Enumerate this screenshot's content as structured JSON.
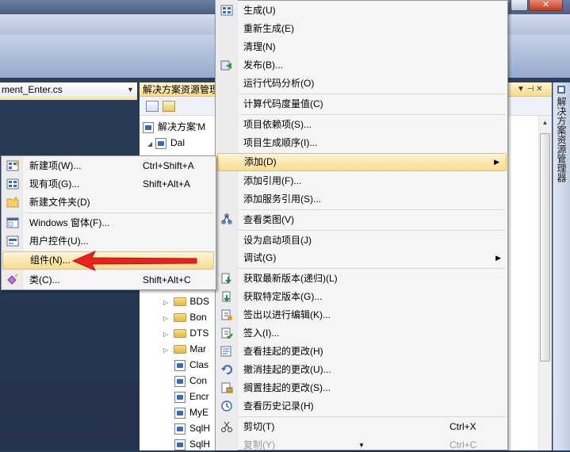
{
  "window": {
    "close_glyph": "✕"
  },
  "doc_tab": {
    "label": "ment_Enter.cs",
    "dropdown": "▼"
  },
  "solution_explorer": {
    "title": "解决方案资源管理",
    "title_buttons": "▼ ⊣ ✕",
    "side_tab": "解决方案资源管理器",
    "tree": {
      "solution": "解决方案'M",
      "project": "Dal",
      "folders": [
        "BDS",
        "Bon",
        "DTS",
        "Mar"
      ],
      "files": [
        "Clas",
        "Con",
        "Encr",
        "MyE",
        "SqlH",
        "SqlH"
      ]
    }
  },
  "context_menu": {
    "items": [
      {
        "label": "生成(U)",
        "icon": "build-icon"
      },
      {
        "label": "重新生成(E)",
        "icon": ""
      },
      {
        "label": "清理(N)",
        "icon": ""
      },
      {
        "label": "发布(B)...",
        "icon": "publish-icon"
      },
      {
        "label": "运行代码分析(O)",
        "icon": ""
      },
      {
        "label": "计算代码度量值(C)",
        "icon": ""
      },
      {
        "label": "项目依赖项(S)...",
        "icon": ""
      },
      {
        "label": "项目生成顺序(I)...",
        "icon": ""
      },
      {
        "label": "添加(D)",
        "icon": "",
        "submenu": true
      },
      {
        "label": "添加引用(F)...",
        "icon": ""
      },
      {
        "label": "添加服务引用(S)...",
        "icon": ""
      },
      {
        "label": "查看类图(V)",
        "icon": "class-diagram-icon"
      },
      {
        "label": "设为启动项目(J)",
        "icon": ""
      },
      {
        "label": "调试(G)",
        "icon": "",
        "submenu": true
      },
      {
        "label": "获取最新版本(递归)(L)",
        "icon": "get-latest-icon"
      },
      {
        "label": "获取特定版本(G)...",
        "icon": "get-specific-icon"
      },
      {
        "label": "签出以进行编辑(K)...",
        "icon": "checkout-icon"
      },
      {
        "label": "签入(I)...",
        "icon": "checkin-icon"
      },
      {
        "label": "查看挂起的更改(H)",
        "icon": "pending-changes-icon"
      },
      {
        "label": "撤消挂起的更改(U)...",
        "icon": "undo-icon"
      },
      {
        "label": "搁置挂起的更改(S)...",
        "icon": "shelve-icon"
      },
      {
        "label": "查看历史记录(H)",
        "icon": "history-icon"
      },
      {
        "label": "剪切(T)",
        "icon": "cut-icon",
        "shortcut": "Ctrl+X"
      },
      {
        "label": "复制(Y)",
        "icon": "",
        "shortcut": "Ctrl+C"
      }
    ],
    "scroll_down": "▼",
    "submenu_arrow": "▶"
  },
  "add_submenu": {
    "items": [
      {
        "label": "新建项(W)...",
        "shortcut": "Ctrl+Shift+A",
        "icon": "new-item-icon"
      },
      {
        "label": "现有项(G)...",
        "shortcut": "Shift+Alt+A",
        "icon": "existing-item-icon"
      },
      {
        "label": "新建文件夹(D)",
        "shortcut": "",
        "icon": "new-folder-icon"
      },
      {
        "label": "Windows 窗体(F)...",
        "shortcut": "",
        "icon": "windows-form-icon"
      },
      {
        "label": "用户控件(U)...",
        "shortcut": "",
        "icon": "user-control-icon"
      },
      {
        "label": "组件(N)...",
        "shortcut": "",
        "icon": "component-icon"
      },
      {
        "label": "类(C)...",
        "shortcut": "Shift+Alt+C",
        "icon": "class-icon"
      }
    ]
  },
  "colors": {
    "highlight": "#f7dd91",
    "arrow": "#e8231c",
    "ide_bg": "#2b3c59"
  }
}
